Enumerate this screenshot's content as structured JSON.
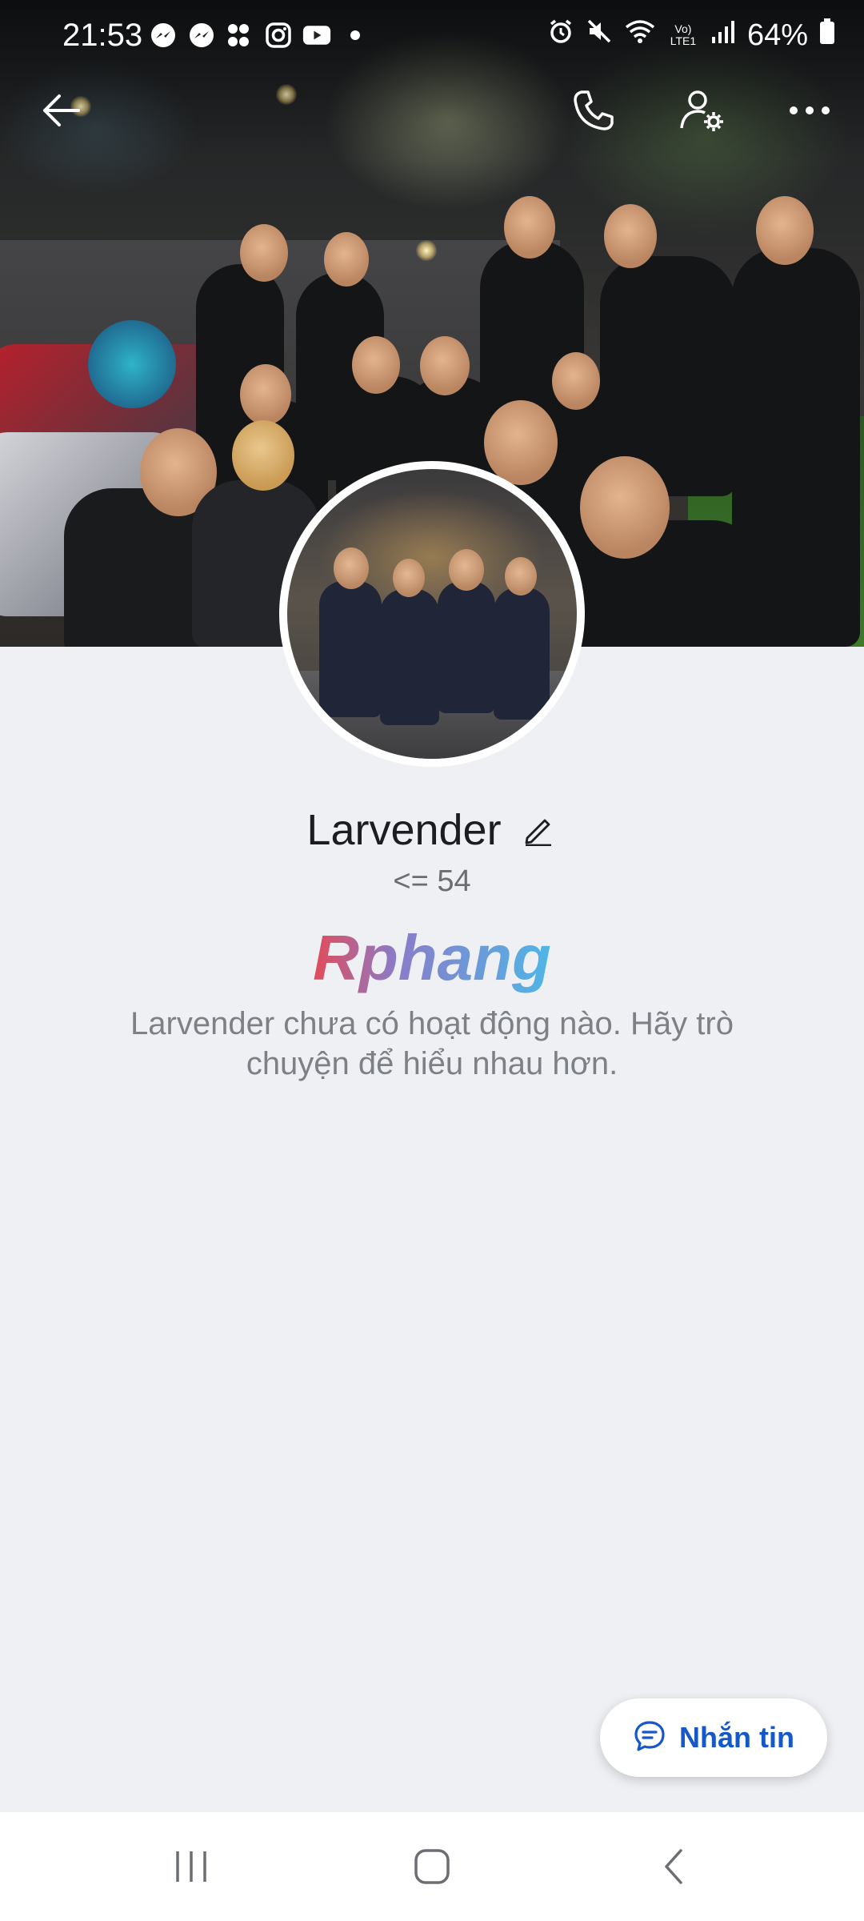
{
  "status_bar": {
    "time": "21:53",
    "battery_percent": "64%",
    "network_label": "Vo) LTE1",
    "notification_apps": [
      "messenger-icon",
      "messenger-icon",
      "momo-icon",
      "instagram-icon",
      "youtube-icon",
      "dot-icon"
    ],
    "system_icons": [
      "alarm-icon",
      "mute-icon",
      "wifi-icon",
      "signal-icon",
      "battery-icon"
    ]
  },
  "top_nav": {
    "back_icon": "back-arrow-icon",
    "call_icon": "phone-icon",
    "settings_icon": "user-settings-icon",
    "more_icon": "more-dots-icon"
  },
  "profile": {
    "name": "Larvender",
    "subtitle": "<= 54",
    "empty_message": "Larvender chưa có hoạt động nào. Hãy trò chuyện để hiểu nhau hơn.",
    "watermark": "Rphang"
  },
  "actions": {
    "message_button_label": "Nhắn tin"
  },
  "colors": {
    "accent": "#1558c9",
    "background": "#eef0f4"
  }
}
